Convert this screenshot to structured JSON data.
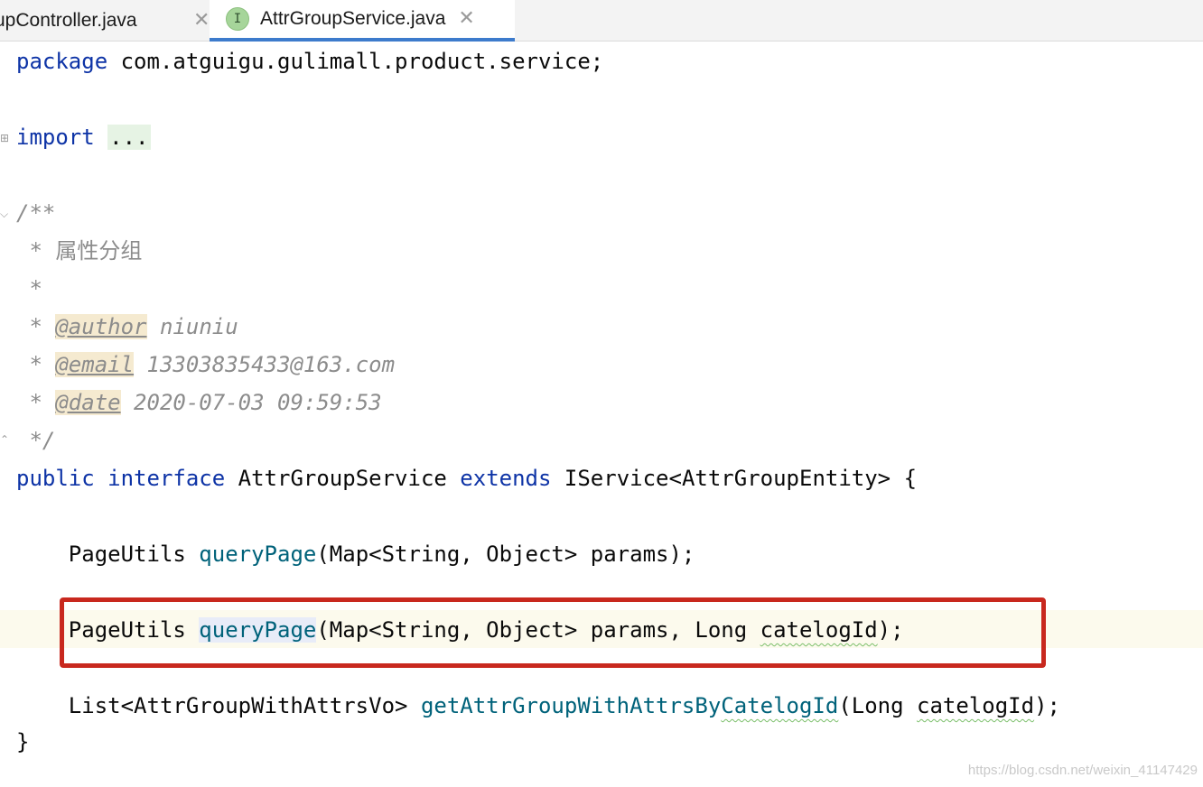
{
  "tabs": [
    {
      "label": "upController.java",
      "close": "✕"
    },
    {
      "label": "AttrGroupService.java",
      "icon_letter": "I",
      "close": "✕"
    }
  ],
  "code": {
    "l1_kw": "package",
    "l1_rest": " com.atguigu.gulimall.product.service;",
    "l2_kw": "import",
    "l2_fold": "...",
    "c1": "/**",
    "c2": " * 属性分组",
    "c3": " *",
    "c4_star": " * ",
    "c4_tag": "@author",
    "c4_val": " niuniu",
    "c5_star": " * ",
    "c5_tag": "@email",
    "c5_val": " 13303835433@163.com",
    "c6_star": " * ",
    "c6_tag": "@date",
    "c6_val": " 2020-07-03 09:59:53",
    "c7": " */",
    "decl_kw1": "public",
    "decl_kw2": "interface",
    "decl_name": " AttrGroupService ",
    "decl_kw3": "extends",
    "decl_rest": " IService<AttrGroupEntity> {",
    "m1_type": "    PageUtils ",
    "m1_fn": "queryPage",
    "m1_rest": "(Map<String, Object> params);",
    "m2_type": "    PageUtils ",
    "m2_fn": "queryPage",
    "m2_rest": "(Map<String, Object> params, Long ",
    "m2_param": "catelogId",
    "m2_end": ");",
    "m3_type": "    List<AttrGroupWithAttrsVo> ",
    "m3_fn_a": "getAttrGroupWithAttrsBy",
    "m3_fn_b": "CatelogId",
    "m3_rest": "(Long ",
    "m3_param": "catelogId",
    "m3_end": ");",
    "close_brace": "}"
  },
  "watermark": "https://blog.csdn.net/weixin_41147429",
  "colors": {
    "keyword": "#0d33a6",
    "method": "#00627a",
    "comment": "#8c8c8c",
    "highlight_box": "#c8281e",
    "tab_underline": "#3d7bcc"
  }
}
